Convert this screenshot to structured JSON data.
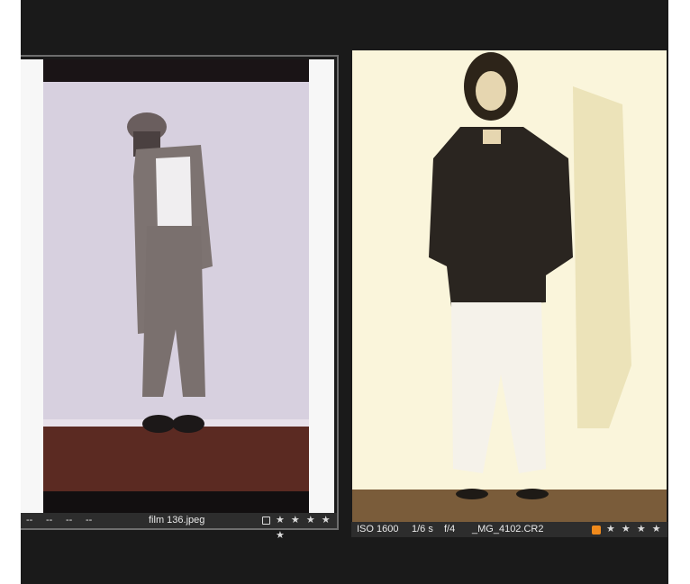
{
  "left_tile": {
    "meta": [
      "--",
      "--",
      "--",
      "--"
    ],
    "filename": "film 136.jpeg",
    "stars": "★ ★ ★ ★ ★",
    "colors": {
      "accent_border": "#6d6d6d"
    }
  },
  "right_tile": {
    "iso": "ISO 1600",
    "shutter": "1/6 s",
    "aperture": "f/4",
    "filename": "_MG_4102.CR2",
    "stars": "★ ★ ★ ★",
    "dot": "•",
    "colors": {
      "color_tag": "#f08a1c"
    }
  },
  "icons": {
    "left_select": "checkbox-icon",
    "right_tag": "color-label-icon",
    "rating": "star-icon"
  }
}
